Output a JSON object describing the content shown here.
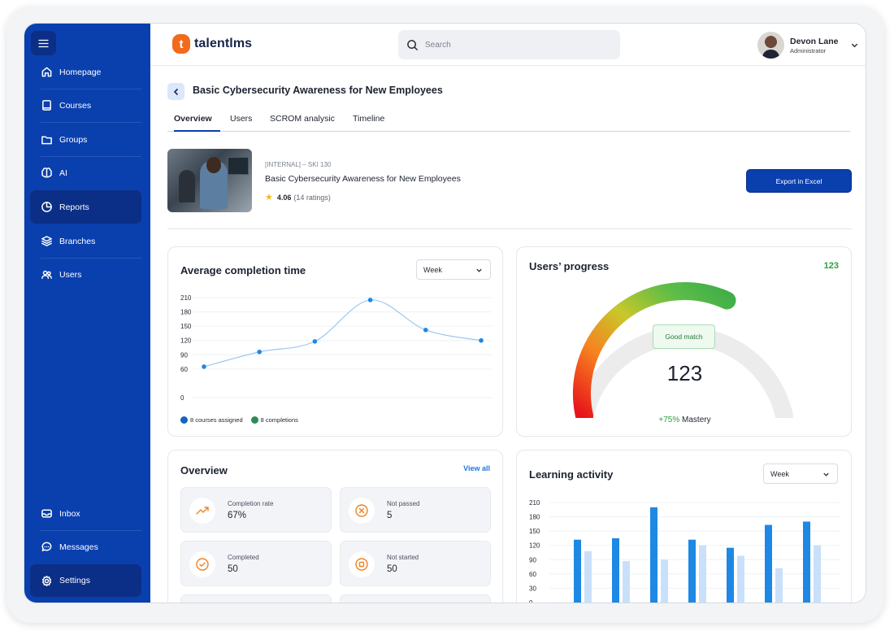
{
  "app": {
    "logo_letter": "t",
    "logo_text": "talentlms",
    "search_placeholder": "Search",
    "user_name": "Devon Lane",
    "user_role": "Administrator"
  },
  "sidebar": {
    "items": [
      {
        "label": "Homepage",
        "icon": "home-icon"
      },
      {
        "label": "Courses",
        "icon": "book-icon"
      },
      {
        "label": "Groups",
        "icon": "folder-icon"
      },
      {
        "label": "AI",
        "icon": "brain-icon"
      },
      {
        "label": "Reports",
        "icon": "pie-chart-icon",
        "active": true
      },
      {
        "label": "Branches",
        "icon": "layers-icon"
      },
      {
        "label": "Users",
        "icon": "users-icon"
      }
    ],
    "bottom_items": [
      {
        "label": "Inbox",
        "icon": "inbox-icon"
      },
      {
        "label": "Messages",
        "icon": "messages-icon"
      },
      {
        "label": "Settings",
        "icon": "gear-icon",
        "active": true
      }
    ]
  },
  "page": {
    "title": "Basic Cybersecurity Awareness for New Employees",
    "tabs": [
      "Overview",
      "Users",
      "SCROM analysic",
      "Timeline"
    ],
    "active_tab": "Overview"
  },
  "course": {
    "code": "[INTERNAL] – SKI 130",
    "name": "Basic Cybersecurity Awareness for New Employees",
    "rating": "4.06",
    "rating_count": "(14 ratings)",
    "export_label": "Export in Excel"
  },
  "completion_card": {
    "title": "Average completion time",
    "period": "Week",
    "legend": [
      {
        "label": "8 courses assigned",
        "color": "#1565c0"
      },
      {
        "label": "8 completions",
        "color": "#2e8b57"
      }
    ]
  },
  "progress_card": {
    "title": "Users’ progress",
    "count": "123",
    "badge": "Good match",
    "value": "123",
    "delta": "+75%",
    "delta_label": "Mastery",
    "fill_fraction": 0.62
  },
  "overview_card": {
    "title": "Overview",
    "view_all": "View all",
    "stats": [
      {
        "label": "Completion rate",
        "value": "67%",
        "icon": "trend-up-icon"
      },
      {
        "label": "Not passed",
        "value": "5",
        "icon": "x-circle-icon"
      },
      {
        "label": "Completed",
        "value": "50",
        "icon": "check-circle-icon"
      },
      {
        "label": "Not started",
        "value": "50",
        "icon": "stop-circle-icon"
      }
    ]
  },
  "activity_card": {
    "title": "Learning activity",
    "period": "Week"
  },
  "chart_data": [
    {
      "type": "line",
      "title": "Average completion time",
      "x": [
        1,
        2,
        3,
        4,
        5,
        6
      ],
      "y": [
        65,
        96,
        118,
        205,
        142,
        120
      ],
      "yticks": [
        0,
        60,
        90,
        120,
        150,
        180,
        210
      ],
      "ylim": [
        0,
        210
      ],
      "grid": true,
      "color": "#1e88e5"
    },
    {
      "type": "bar",
      "title": "Learning activity",
      "categories": [
        "1",
        "2",
        "3",
        "4",
        "5",
        "6",
        "7"
      ],
      "series": [
        {
          "values": [
            132,
            135,
            200,
            132,
            115,
            163,
            170
          ],
          "color": "#1e88e5"
        },
        {
          "values": [
            108,
            87,
            90,
            120,
            98,
            72,
            120
          ],
          "color": "#c9e0fa"
        }
      ],
      "yticks": [
        0,
        30,
        60,
        90,
        120,
        150,
        180,
        210
      ],
      "ylim": [
        0,
        210
      ],
      "grid": true
    }
  ]
}
